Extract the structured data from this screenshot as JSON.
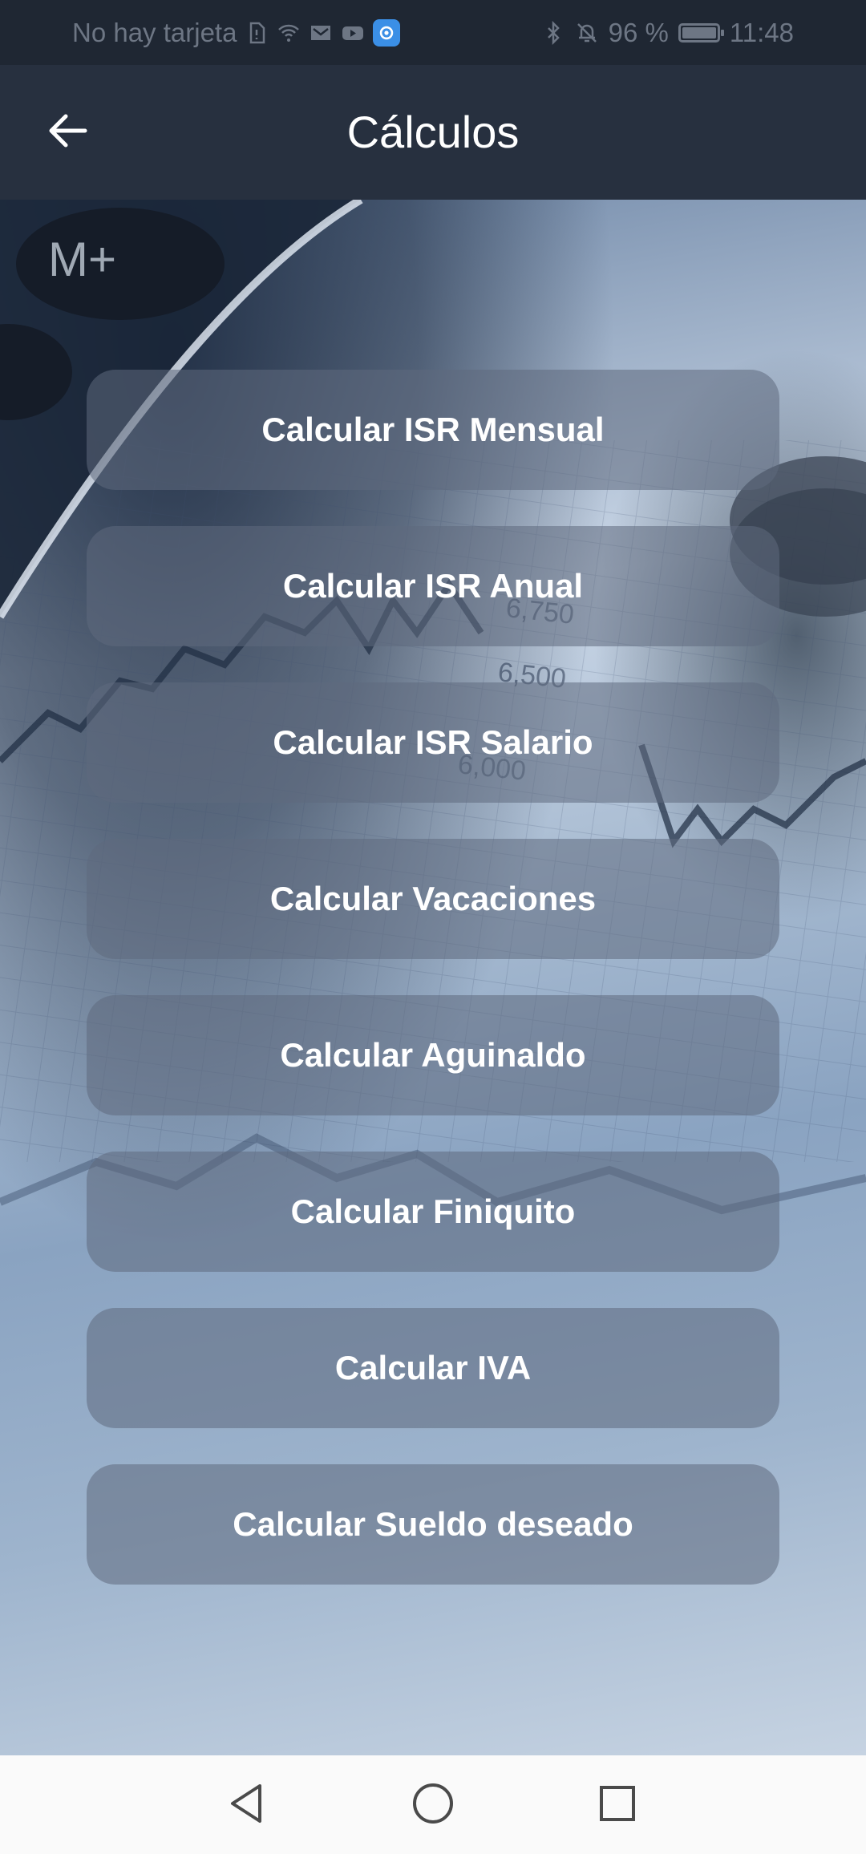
{
  "status_bar": {
    "carrier": "No hay tarjeta",
    "battery": "96 %",
    "time": "11:48",
    "icons": [
      "sim-icon",
      "wifi-icon",
      "mail-icon",
      "youtube-icon",
      "app-icon",
      "bluetooth-icon",
      "bell-off-icon",
      "battery-icon"
    ]
  },
  "header": {
    "title": "Cálculos",
    "back_icon": "arrow-left-icon"
  },
  "menu": {
    "items": [
      {
        "label": "Calcular ISR Mensual"
      },
      {
        "label": "Calcular ISR Anual"
      },
      {
        "label": "Calcular ISR Salario"
      },
      {
        "label": "Calcular Vacaciones"
      },
      {
        "label": "Calcular Aguinaldo"
      },
      {
        "label": "Calcular Finiquito"
      },
      {
        "label": "Calcular IVA"
      },
      {
        "label": "Calcular Sueldo deseado"
      }
    ]
  },
  "nav_bar": {
    "icons": [
      "back-triangle-icon",
      "home-circle-icon",
      "recents-square-icon"
    ]
  }
}
